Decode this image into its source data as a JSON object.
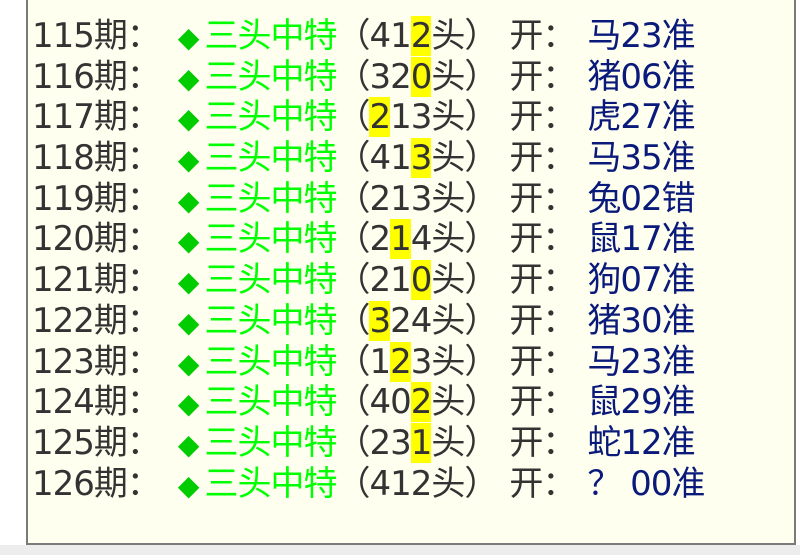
{
  "rows": [
    {
      "period": "115期",
      "colon": "：",
      "diamond": "◆",
      "title": "三头中特",
      "pre": "（41",
      "hl": "2",
      "post": "头）",
      "open": "开：",
      "result": "马23准"
    },
    {
      "period": "116期",
      "colon": "：",
      "diamond": "◆",
      "title": "三头中特",
      "pre": "（32",
      "hl": "0",
      "post": "头）",
      "open": "开：",
      "result": "猪06准"
    },
    {
      "period": "117期",
      "colon": "：",
      "diamond": "◆",
      "title": "三头中特",
      "pre": "（",
      "hl": "2",
      "post": "13头）",
      "open": "开：",
      "result": "虎27准"
    },
    {
      "period": "118期",
      "colon": "：",
      "diamond": "◆",
      "title": "三头中特",
      "pre": "（41",
      "hl": "3",
      "post": "头）",
      "open": "开：",
      "result": "马35准"
    },
    {
      "period": "119期",
      "colon": "：",
      "diamond": "◆",
      "title": "三头中特",
      "pre": "（213头）",
      "hl": "",
      "post": "",
      "open": "开：",
      "result": "兔02错"
    },
    {
      "period": "120期",
      "colon": "：",
      "diamond": "◆",
      "title": "三头中特",
      "pre": "（2",
      "hl": "1",
      "post": "4头）",
      "open": "开：",
      "result": "鼠17准"
    },
    {
      "period": "121期",
      "colon": "：",
      "diamond": "◆",
      "title": "三头中特",
      "pre": "（21",
      "hl": "0",
      "post": "头）",
      "open": "开：",
      "result": "狗07准"
    },
    {
      "period": "122期",
      "colon": "：",
      "diamond": "◆",
      "title": "三头中特",
      "pre": "（",
      "hl": "3",
      "post": "24头）",
      "open": "开：",
      "result": "猪30准"
    },
    {
      "period": "123期",
      "colon": "：",
      "diamond": "◆",
      "title": "三头中特",
      "pre": "（1",
      "hl": "2",
      "post": "3头）",
      "open": "开：",
      "result": "马23准"
    },
    {
      "period": "124期",
      "colon": "：",
      "diamond": "◆",
      "title": "三头中特",
      "pre": "（40",
      "hl": "2",
      "post": "头）",
      "open": "开：",
      "result": "鼠29准"
    },
    {
      "period": "125期",
      "colon": "：",
      "diamond": "◆",
      "title": "三头中特",
      "pre": "（23",
      "hl": "1",
      "post": "头）",
      "open": "开：",
      "result": "蛇12准"
    },
    {
      "period": "126期",
      "colon": "：",
      "diamond": "◆",
      "title": "三头中特",
      "pre": "（412头）",
      "hl": "",
      "post": "",
      "open": "开：",
      "result": "？ 00准"
    }
  ],
  "colors": {
    "title": "#00ff00",
    "highlight": "#ffff00",
    "result": "#0a1a7a",
    "text": "#333333",
    "panel_bg": "#fffff0"
  }
}
